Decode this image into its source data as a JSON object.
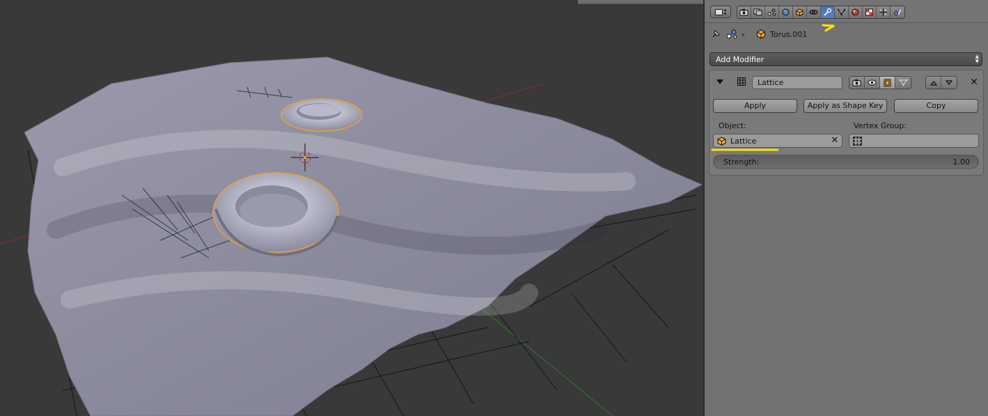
{
  "viewport": {
    "background": "#393939",
    "mesh_color": "#8f8fa2",
    "selection_outline": "#f0a030",
    "axis_x_color": "#9a3030",
    "axis_y_color": "#3a8a3a"
  },
  "properties": {
    "header": {
      "editor_type_icon": "properties-editor-icon",
      "context_tabs": [
        {
          "name": "render",
          "icon": "camera-icon"
        },
        {
          "name": "render-layers",
          "icon": "layers-icon"
        },
        {
          "name": "scene",
          "icon": "scene-icon"
        },
        {
          "name": "world",
          "icon": "world-icon"
        },
        {
          "name": "object",
          "icon": "object-cube-icon"
        },
        {
          "name": "constraints",
          "icon": "link-icon"
        },
        {
          "name": "modifiers",
          "icon": "wrench-icon",
          "active": true
        },
        {
          "name": "data",
          "icon": "mesh-data-icon"
        },
        {
          "name": "material",
          "icon": "material-icon"
        },
        {
          "name": "texture",
          "icon": "texture-icon"
        },
        {
          "name": "particles",
          "icon": "particles-icon"
        },
        {
          "name": "physics",
          "icon": "physics-icon"
        }
      ],
      "active_color": "#5680c8"
    },
    "breadcrumb": {
      "object_name": "Torus.001"
    },
    "add_modifier_label": "Add Modifier",
    "modifier": {
      "name": "Lattice",
      "apply_label": "Apply",
      "apply_shape_key_label": "Apply as Shape Key",
      "copy_label": "Copy",
      "object_label": "Object:",
      "object_value": "Lattice",
      "vertex_group_label": "Vertex Group:",
      "vertex_group_value": "",
      "strength_label": "Strength:",
      "strength_value": "1.00"
    },
    "annotation_color": "#f2e600"
  }
}
